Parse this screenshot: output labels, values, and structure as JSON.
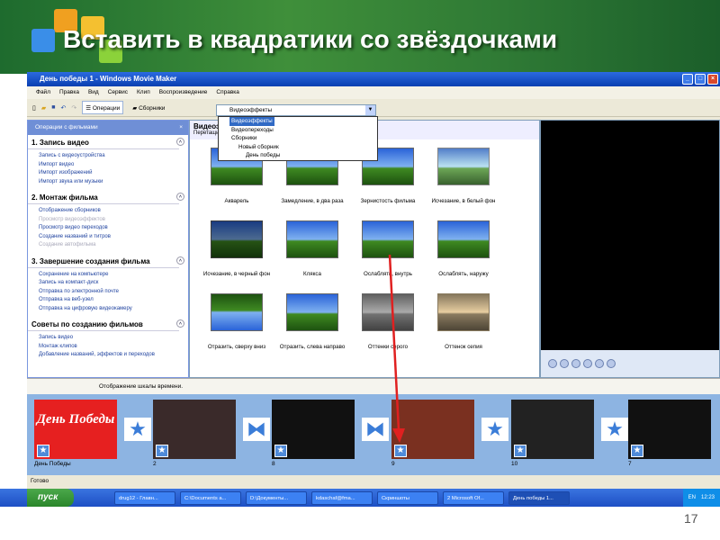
{
  "slide": {
    "title": "Вставить в квадратики со звёздочками",
    "page_number": "17"
  },
  "window": {
    "title": "День победы 1 - Windows Movie Maker",
    "menu": [
      "Файл",
      "Правка",
      "Вид",
      "Сервис",
      "Клип",
      "Воспроизведение",
      "Справка"
    ],
    "toolbar": {
      "operations": "Операции",
      "collections": "Сборники",
      "combo_value": "Видеоэффекты"
    },
    "dropdown": [
      "Видеоэффекты",
      "Видеопереходы",
      "Сборники",
      "Новый сборник",
      "День победы"
    ]
  },
  "tasks": {
    "header": "Операции с фильмами",
    "sections": [
      {
        "title": "1. Запись видео",
        "links": [
          "Запись с видеоустройства",
          "Импорт видео",
          "Импорт изображений",
          "Импорт звука или музыки"
        ]
      },
      {
        "title": "2. Монтаж фильма",
        "links": [
          "Отображение сборников",
          "Просмотр видеоэффектов",
          "Просмотр видео переходов",
          "Создание названий и титров",
          "Создание автофильма"
        ]
      },
      {
        "title": "3. Завершение создания фильма",
        "links": [
          "Сохранение на компьютере",
          "Запись на компакт-диск",
          "Отправка по электронной почте",
          "Отправка на веб-узел",
          "Отправка на цифровую видеокамеру"
        ]
      },
      {
        "title": "Советы по созданию фильмов",
        "links": [
          "Запись видео",
          "Монтаж клипов",
          "Добавление названий, эффектов и переходов"
        ]
      }
    ]
  },
  "content": {
    "title": "Видеоэффекты",
    "subtitle": "Перетащите видеоэффект на клип в раскадровке, расположенной ниже.",
    "effects": [
      "Акварель",
      "Замедление, в два раза",
      "Зернистость фильма",
      "Исчезание, в белый фон",
      "Исчезание, в черный фон",
      "Клякса",
      "Ослаблять, внутрь",
      "Ослаблять, наружу",
      "Отразить, сверху вниз",
      "Отразить, слева направо",
      "Оттенки серого",
      "Оттенок сепия"
    ]
  },
  "timeline": {
    "toggle_label": "Отображение шкалы времени.",
    "clips": [
      {
        "label": "День Победы",
        "text": "День Победы"
      },
      {
        "label": "2"
      },
      {
        "label": "8"
      },
      {
        "label": "9"
      },
      {
        "label": "10"
      },
      {
        "label": "7"
      }
    ]
  },
  "status": "Готово",
  "taskbar": {
    "start": "пуск",
    "items": [
      "drug12 - Главн...",
      "C:\\Documents a...",
      "D:\\Документы...",
      "kdaschaf@fma...",
      "Скриншоты",
      "2 Microsoft Of...",
      "День победы 1..."
    ],
    "lang": "EN",
    "clock": "12:23"
  },
  "colors": {
    "accent": "#316ac5",
    "arrow": "#e02020",
    "storyboard": "#8db4e2"
  }
}
